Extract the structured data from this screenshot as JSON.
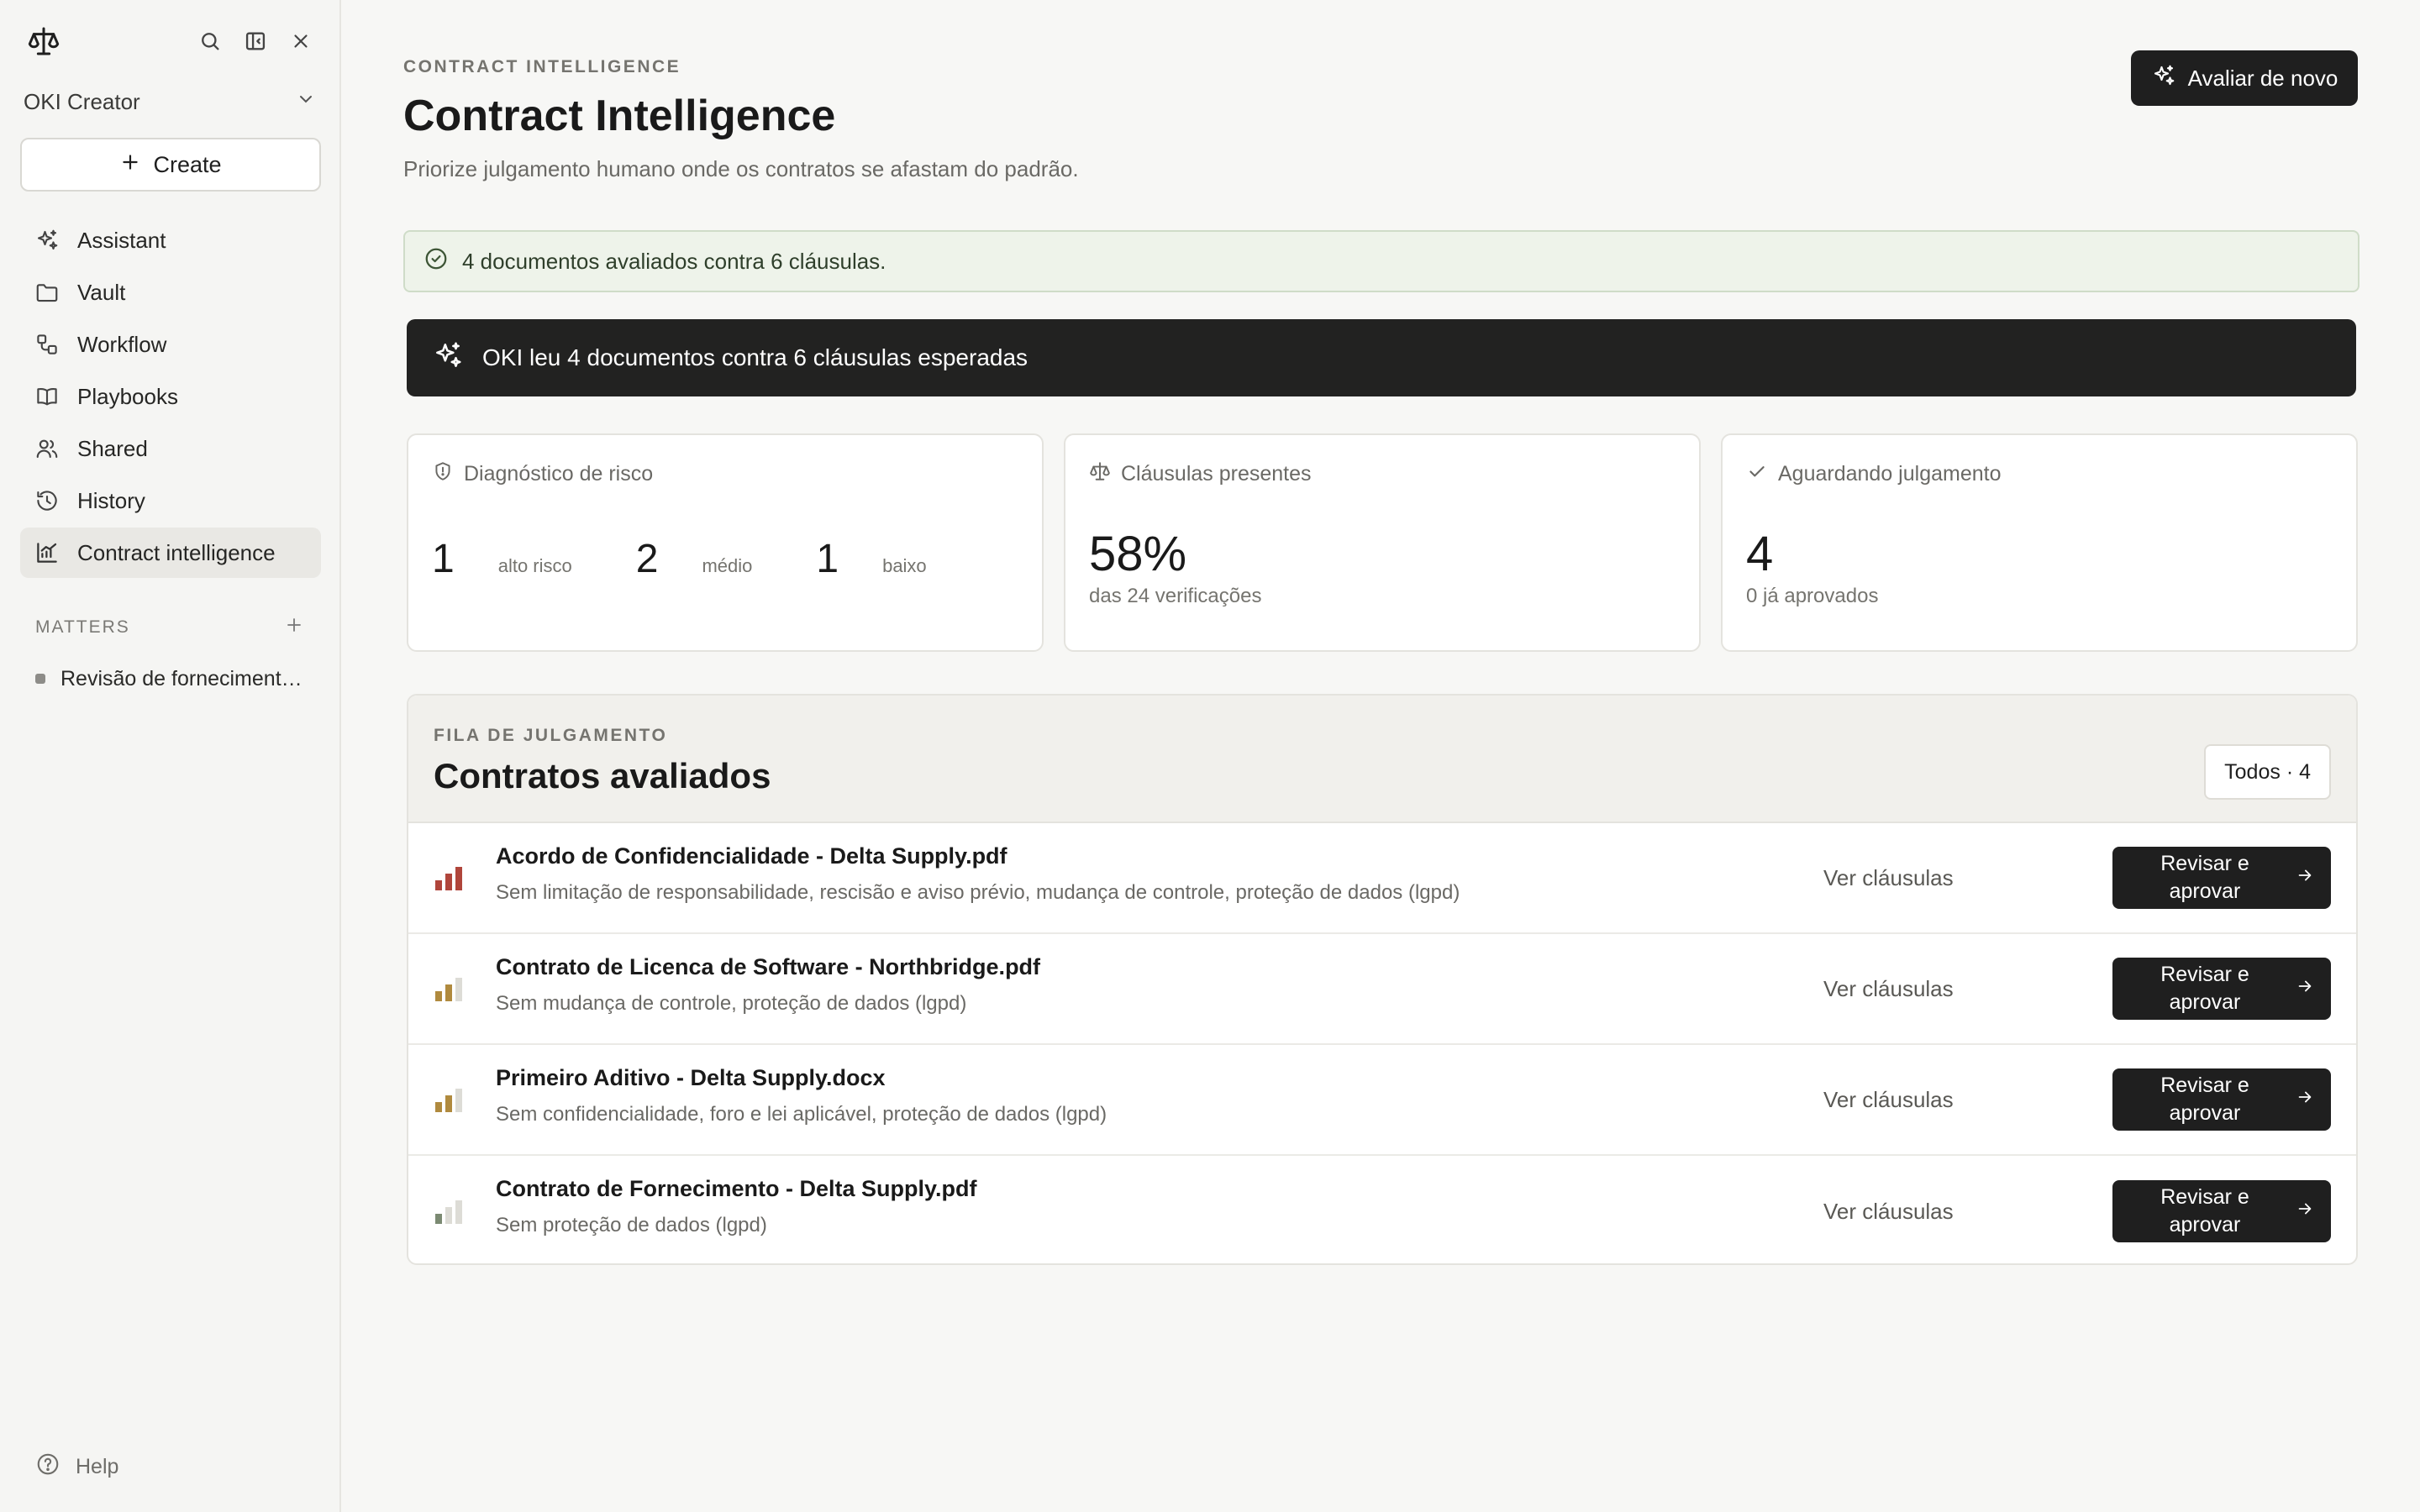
{
  "sidebar": {
    "workspace": "OKI Creator",
    "create_label": "Create",
    "nav": [
      {
        "label": "Assistant",
        "icon": "sparkles-icon"
      },
      {
        "label": "Vault",
        "icon": "folder-icon"
      },
      {
        "label": "Workflow",
        "icon": "workflow-icon"
      },
      {
        "label": "Playbooks",
        "icon": "book-icon"
      },
      {
        "label": "Shared",
        "icon": "users-icon"
      },
      {
        "label": "History",
        "icon": "history-icon"
      },
      {
        "label": "Contract intelligence",
        "icon": "chart-icon",
        "active": true
      }
    ],
    "matters_heading": "MATTERS",
    "matters": [
      "Revisão de fornecimento Delta Supply"
    ],
    "help_label": "Help"
  },
  "header": {
    "eyebrow": "CONTRACT INTELLIGENCE",
    "title": "Contract Intelligence",
    "subtitle": "Priorize julgamento humano onde os contratos se afastam do padrão.",
    "reevaluate_label": "Avaliar de novo"
  },
  "success_banner": "4 documentos avaliados contra 6 cláusulas.",
  "info_banner": "OKI leu 4 documentos contra 6 cláusulas esperadas",
  "cards": {
    "risk": {
      "title": "Diagnóstico de risco",
      "high": "1",
      "high_label": "alto risco",
      "medium": "2",
      "medium_label": "médio",
      "low": "1",
      "low_label": "baixo"
    },
    "clauses": {
      "title": "Cláusulas presentes",
      "value": "58%",
      "sub": "das 24 verificações"
    },
    "pending": {
      "title": "Aguardando julgamento",
      "value": "4",
      "sub": "0 já aprovados"
    }
  },
  "queue": {
    "eyebrow": "FILA DE JULGAMENTO",
    "title": "Contratos avaliados",
    "filter_label": "Todos · 4",
    "view_label": "Ver cláusulas",
    "review_label": "Revisar e aprovar",
    "rows": [
      {
        "name": "Acordo de Confidencialidade - Delta Supply.pdf",
        "missing": "Sem limitação de responsabilidade, rescisão e aviso prévio, mudança de controle, proteção de dados (lgpd)",
        "risk": "high",
        "level": 3
      },
      {
        "name": "Contrato de Licenca de Software - Northbridge.pdf",
        "missing": "Sem mudança de controle, proteção de dados (lgpd)",
        "risk": "medium",
        "level": 2
      },
      {
        "name": "Primeiro Aditivo - Delta Supply.docx",
        "missing": "Sem confidencialidade, foro e lei aplicável, proteção de dados (lgpd)",
        "risk": "medium",
        "level": 2
      },
      {
        "name": "Contrato de Fornecimento - Delta Supply.pdf",
        "missing": "Sem proteção de dados (lgpd)",
        "risk": "low",
        "level": 1
      }
    ]
  },
  "colors": {
    "risk_high": "#b0453b",
    "risk_medium": "#b08a3e",
    "risk_low": "#7b8a72",
    "bar_inactive": "#dddcd6"
  }
}
